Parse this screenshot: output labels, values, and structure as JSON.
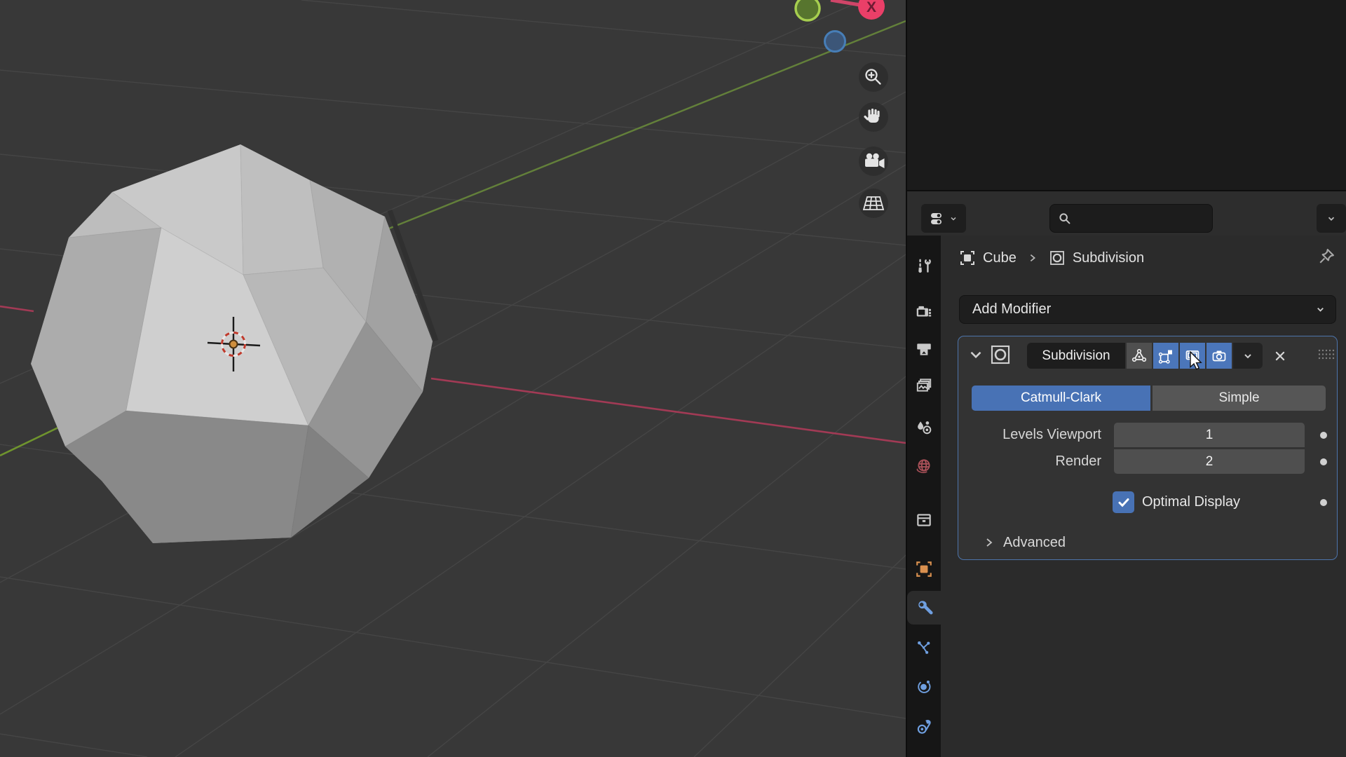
{
  "window": {
    "app": "Blender"
  },
  "viewport": {
    "gizmo": {
      "x_label": "X",
      "axes": [
        "x",
        "y",
        "z"
      ]
    },
    "nav_buttons": [
      "zoom",
      "pan",
      "camera-view",
      "toggle-grid"
    ],
    "scene_object": "Cube"
  },
  "properties": {
    "breadcrumb": {
      "object": "Cube",
      "modifier": "Subdivision"
    },
    "add_modifier": "Add Modifier",
    "modifier": {
      "name": "Subdivision",
      "types": [
        "Catmull-Clark",
        "Simple"
      ],
      "active_type": "Catmull-Clark",
      "rows": [
        {
          "label": "Levels Viewport",
          "value": "1"
        },
        {
          "label": "Render",
          "value": "2"
        }
      ],
      "optimal_display": {
        "label": "Optimal Display",
        "checked": true
      },
      "advanced": "Advanced"
    },
    "tabs": [
      "tool",
      "render",
      "output",
      "view-layer",
      "scene",
      "world",
      "collection",
      "object",
      "modifiers",
      "particles",
      "physics",
      "constraints"
    ],
    "active_tab": "modifiers"
  },
  "colors": {
    "accent_blue": "#4872b5",
    "panel_outline": "#4d74ab",
    "axis_x_red": "#a23a55",
    "axis_y_green": "#6f942e",
    "object_orange": "#d9904f",
    "icon_blue": "#6f9fe0",
    "world_red": "#a85058",
    "viewport_bg": "#383838"
  }
}
